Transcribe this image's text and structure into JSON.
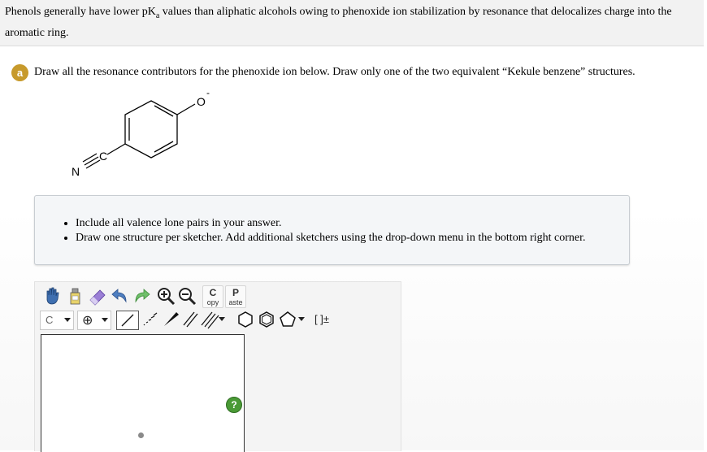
{
  "intro": {
    "text": "Phenols generally have lower pK",
    "sub": "a",
    "text2": " values than aliphatic alcohols owing to phenoxide ion stabilization by resonance that delocalizes charge into the aromatic ring."
  },
  "question": {
    "badge": "a",
    "prompt": "Draw all the resonance contributors for the phenoxide ion below. Draw only one of the two equivalent “Kekule benzene” structures."
  },
  "molecule": {
    "oxygen": "O",
    "charge": "-",
    "carbon": "C",
    "nitrogen": "N"
  },
  "notes": [
    "Include all valence lone pairs in your answer.",
    "Draw one structure per sketcher. Add additional sketchers using the drop-down menu in the bottom right corner."
  ],
  "toolbar": {
    "copy_big": "C",
    "copy_small": "opy",
    "paste_big": "P",
    "paste_small": "aste",
    "element_label": "C",
    "bracket_label": "[ ]±"
  },
  "canvas": {
    "help_label": "?"
  }
}
